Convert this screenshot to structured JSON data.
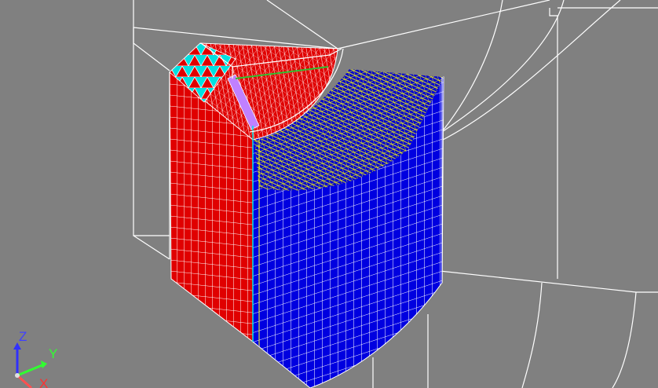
{
  "viewport": {
    "background": "#808080",
    "bounding_frame_color": "#ffffff",
    "mesh_line_color": "#ffffff",
    "seam_color": "#ffff00"
  },
  "regions": {
    "left_face_color": "#e00000",
    "right_face_color": "#0000e0",
    "top_left_color": "#e00000",
    "top_right_seam_color": "#ffff00",
    "triangles_color": "#00e6e6",
    "strip_color": "#c080ff"
  },
  "triad": {
    "z_label": "Z",
    "y_label": "Y",
    "x_label": "X",
    "z_color": "#3030ff",
    "y_color": "#30ff30",
    "x_color": "#ff3030"
  }
}
